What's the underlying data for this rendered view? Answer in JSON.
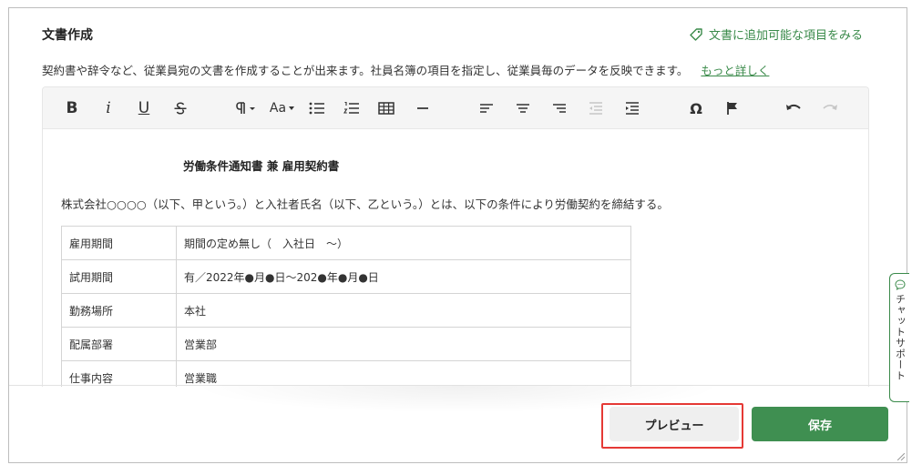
{
  "header": {
    "title": "文書作成",
    "add_items_link": "文書に追加可能な項目をみる"
  },
  "description": {
    "text": "契約書や辞令など、従業員宛の文書を作成することが出来ます。社員名簿の項目を指定し、従業員毎のデータを反映できます。",
    "more_link": "もっと詳しく"
  },
  "toolbar": {
    "bold": "B",
    "italic": "i",
    "underline": "U",
    "font_size": "Aa",
    "omega": "Ω",
    "icons": [
      "strikethrough-icon",
      "paragraph-icon",
      "font-size-icon",
      "bullet-list-icon",
      "numbered-list-icon",
      "table-icon",
      "horizontal-rule-icon",
      "align-left-icon",
      "align-center-icon",
      "align-right-icon",
      "outdent-icon",
      "indent-icon",
      "special-char-icon",
      "flag-icon",
      "undo-icon",
      "redo-icon"
    ]
  },
  "document": {
    "title": "労働条件通知書 兼 雇用契約書",
    "intro": "株式会社○○○○（以下、甲という。）と入社者氏名（以下、乙という。）とは、以下の条件により労働契約を締結する。",
    "rows": [
      {
        "key": "雇用期間",
        "value": "期間の定め無し（　入社日　〜）"
      },
      {
        "key": "試用期間",
        "value": "有／2022年●月●日〜202●年●月●日"
      },
      {
        "key": "勤務場所",
        "value": "本社"
      },
      {
        "key": "配属部署",
        "value": "営業部"
      },
      {
        "key": "仕事内容",
        "value": "営業職"
      }
    ]
  },
  "footer": {
    "preview_label": "プレビュー",
    "save_label": "保存"
  },
  "chat_support": {
    "label": "チャットサポート"
  },
  "colors": {
    "accent_green": "#3f8f51",
    "highlight_red": "#e53935"
  }
}
